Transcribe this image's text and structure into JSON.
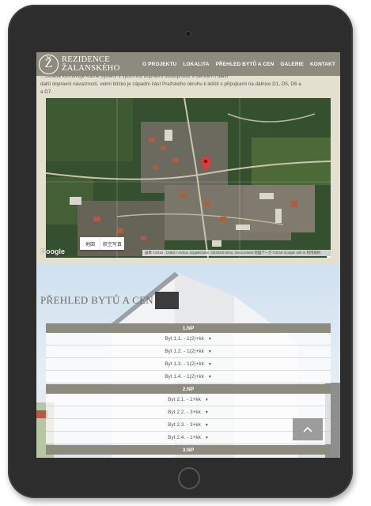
{
  "site": {
    "logo_mark": "Ž",
    "logo_line1": "REZIDENCE",
    "logo_line2": "ŽALANSKÉHO"
  },
  "nav": {
    "items": [
      "O PROJEKTU",
      "LOKALITA",
      "PŘEHLED BYTŮ A CEN",
      "GALERIE",
      "KONTAKT"
    ]
  },
  "intro": {
    "line1": "…lokalita kombinuje klidné bydlení s výbornou dopravní dostupností s centrem i další",
    "line2": "další dopravní návazností, velmi blízko je západní část Pražského okruhu k letišti s připojkami na dálnice D1, D5, D6 a",
    "line3": "a D7."
  },
  "map": {
    "btn_map": "地図",
    "btn_satellite": "航空写真",
    "google": "Google",
    "credits": "画像 ©2016 , CNES / Airbus, DigitalGlobe, GEODIS Brno, GeoContent    地図データ ©2016 Google    100 m    利用規約",
    "zoom_in": "+",
    "zoom_out": "−",
    "colors": {
      "pin": "#e53935",
      "pegman": "#f4b400"
    }
  },
  "prices": {
    "title": "PŘEHLED BYTŮ A CEN",
    "floors": [
      {
        "label": "1.NP",
        "apartments": [
          "Byt 1.1. - 1(2)+kk",
          "Byt 1.2. - 1(2)+kk",
          "Byt 1.3. - 1(2)+kk",
          "Byt 1.4. - 1(2)+kk"
        ]
      },
      {
        "label": "2.NP",
        "apartments": [
          "Byt 2.1. - 1+kk",
          "Byt 2.2. - 3+kk",
          "Byt 2.3. - 3+kk",
          "Byt 2.4. - 1+kk"
        ]
      },
      {
        "label": "3.NP",
        "apartments": []
      }
    ]
  },
  "scroll_top": {
    "icon": "chevron-up-icon"
  },
  "colors": {
    "accent": "#8d8a7e",
    "background": "#e3e0cf"
  }
}
